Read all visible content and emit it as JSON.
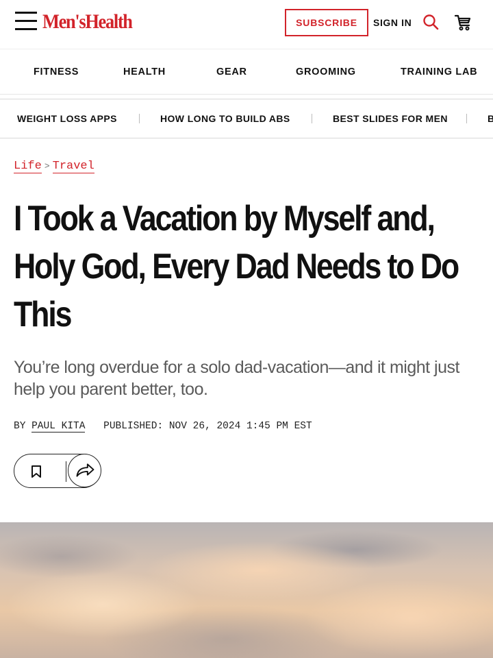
{
  "header": {
    "logo_text": "Men'sHealth",
    "subscribe_label": "SUBSCRIBE",
    "signin_label": "SIGN IN",
    "brand_color": "#d2232a"
  },
  "nav": {
    "items": [
      "FITNESS",
      "HEALTH",
      "GEAR",
      "GROOMING",
      "TRAINING LAB"
    ]
  },
  "trending": {
    "items": [
      "WEIGHT LOSS APPS",
      "HOW LONG TO BUILD ABS",
      "BEST SLIDES FOR MEN",
      "B"
    ]
  },
  "breadcrumb": {
    "items": [
      "Life",
      "Travel"
    ],
    "separator": ">"
  },
  "article": {
    "headline": "I Took a Vacation by Myself and, Holy God, Every Dad Needs to Do This",
    "dek": "You’re long overdue for a solo dad-vacation—and it might just help you parent better, too.",
    "byline_prefix": "BY",
    "author": "PAUL KITA",
    "published": "PUBLISHED: NOV 26, 2024 1:45 PM EST"
  },
  "icons": {
    "menu": "hamburger-menu-icon",
    "search": "search-icon",
    "cart": "cart-icon",
    "bookmark": "bookmark-icon",
    "share": "share-arrow-icon"
  }
}
